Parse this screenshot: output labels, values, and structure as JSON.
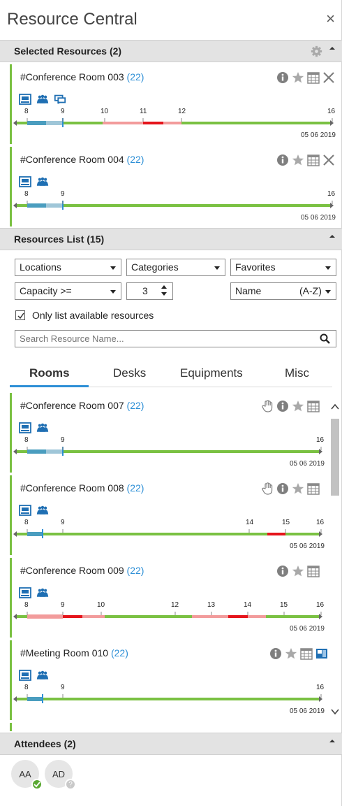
{
  "app": {
    "title": "Resource Central",
    "close": "×"
  },
  "selected": {
    "header": "Selected Resources (2)",
    "cards": [
      {
        "name": "#Conference Room 003",
        "count": "(22)",
        "date": "05 06 2019",
        "features": [
          "projector-icon",
          "people-icon",
          "screen-chat-icon"
        ],
        "timeline": {
          "start": 8,
          "end": 16,
          "ticks": [
            "8",
            "9",
            "10",
            "11",
            "12",
            "16"
          ]
        }
      },
      {
        "name": "#Conference Room 004",
        "count": "(22)",
        "date": "05 06 2019",
        "features": [
          "projector-icon",
          "people-icon"
        ],
        "timeline": {
          "start": 8,
          "end": 16,
          "ticks": [
            "8",
            "9",
            "16"
          ]
        }
      }
    ]
  },
  "resources_list": {
    "header": "Resources List (15)",
    "filters": {
      "locations": "Locations",
      "categories": "Categories",
      "favorites": "Favorites",
      "capacity": "Capacity >=",
      "capacity_value": "3",
      "sort_name": "Name",
      "sort_order": "(A-Z)",
      "only_available": "Only list available resources",
      "only_available_checked": true,
      "search_placeholder": "Search Resource Name..."
    },
    "tabs": [
      "Rooms",
      "Desks",
      "Equipments",
      "Misc"
    ],
    "active_tab": "Rooms",
    "items": [
      {
        "name": "#Conference Room 007",
        "count": "(22)",
        "date": "05 06 2019",
        "ticks": [
          "8",
          "9",
          "16"
        ]
      },
      {
        "name": "#Conference Room 008",
        "count": "(22)",
        "date": "05 06 2019",
        "ticks": [
          "8",
          "9",
          "14",
          "15",
          "16"
        ]
      },
      {
        "name": "#Conference Room 009",
        "count": "(22)",
        "date": "05 06 2019",
        "ticks": [
          "8",
          "9",
          "10",
          "12",
          "13",
          "14",
          "15",
          "16"
        ]
      },
      {
        "name": "#Meeting Room 010",
        "count": "(22)",
        "date": "05 06 2019",
        "ticks": [
          "8",
          "9",
          "16"
        ]
      }
    ]
  },
  "attendees": {
    "header": "Attendees (2)",
    "people": [
      {
        "initials": "AA",
        "status": "accepted"
      },
      {
        "initials": "AD",
        "status": "unknown"
      }
    ]
  },
  "colors": {
    "accent": "#2d8fd6",
    "available": "#7ac142",
    "busy": "#e5141b",
    "tentative": "#f29b9b",
    "past": "#4a9dbf"
  }
}
